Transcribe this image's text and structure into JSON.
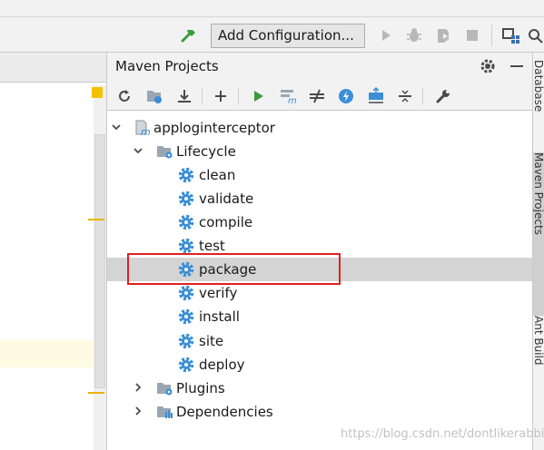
{
  "toolbar": {
    "run_config_label": "Add Configuration...",
    "icons": [
      "hammer-icon",
      "run-icon",
      "debug-icon",
      "coverage-icon",
      "stop-icon",
      "project-structure-icon",
      "search-icon"
    ]
  },
  "maven_panel": {
    "title": "Maven Projects",
    "toolbar_icons": [
      "reimport-icon",
      "generate-sources-icon",
      "download-icon",
      "add-icon",
      "run-maven-goal-icon",
      "execute-goal-icon",
      "toggle-offline-icon",
      "skip-tests-icon",
      "show-dependencies-icon",
      "collapse-all-icon",
      "settings-wrench-icon"
    ],
    "tree": {
      "project": "apploginterceptor",
      "lifecycle_label": "Lifecycle",
      "lifecycle_goals": [
        "clean",
        "validate",
        "compile",
        "test",
        "package",
        "verify",
        "install",
        "site",
        "deploy"
      ],
      "selected_goal": "package",
      "plugins_label": "Plugins",
      "dependencies_label": "Dependencies"
    }
  },
  "side_tabs": [
    "Database",
    "Maven Projects",
    "Ant Build"
  ],
  "watermark": "https://blog.csdn.net/dontlikerabbit",
  "colors": {
    "accent_green": "#3d9a3d",
    "gear_blue": "#3a8fd6",
    "highlight_red": "#e02020",
    "selection_grey": "#d4d4d4"
  }
}
